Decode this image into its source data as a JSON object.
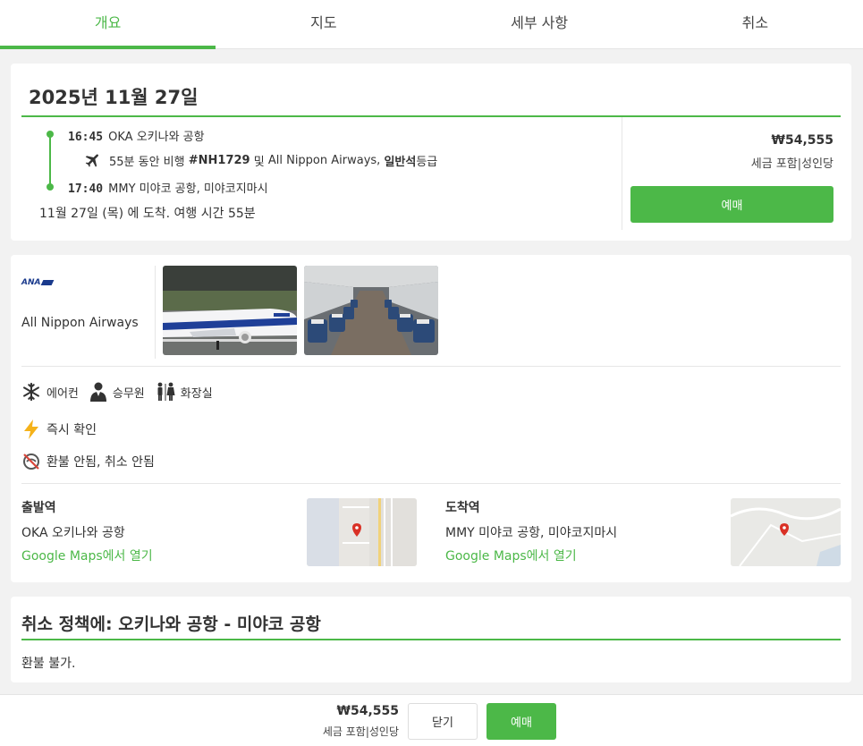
{
  "tabs": [
    {
      "label": "개요",
      "active": true
    },
    {
      "label": "지도"
    },
    {
      "label": "세부 사항"
    },
    {
      "label": "취소"
    }
  ],
  "summary": {
    "date": "2025년 11월 27일",
    "departure": {
      "time": "16:45",
      "place": "OKA 오키나와 공항"
    },
    "flight": {
      "duration": "55분 동안 비행",
      "number": "#NH1729",
      "connector": "및",
      "airline": "All Nippon Airways,",
      "class": "일반석",
      "class_suffix": "등급"
    },
    "arrival": {
      "time": "17:40",
      "place": "MMY 미야코 공항, 미야코지마시"
    },
    "arrive_text": "11월 27일 (목) 에 도착. 여행 시간 55분",
    "price": "₩54,555",
    "tax": "세금 포함|성인당",
    "book_label": "예매"
  },
  "details": {
    "airline_logo": "ANA",
    "airline_name": "All Nippon Airways",
    "amenities": [
      {
        "icon": "snowflake-icon",
        "label": "에어컨"
      },
      {
        "icon": "flight-attendant-icon",
        "label": "승무원"
      },
      {
        "icon": "restroom-icon",
        "label": "화장실"
      }
    ],
    "instant": "즉시 확인",
    "refund": "환불 안됨, 취소 안됨",
    "departure_station": {
      "heading": "출발역",
      "name": "OKA 오키나와 공항",
      "link": "Google Maps에서 열기"
    },
    "arrival_station": {
      "heading": "도착역",
      "name": "MMY 미야코 공항, 미야코지마시",
      "link": "Google Maps에서 열기"
    }
  },
  "policy": {
    "title": "취소 정책에: 오키나와 공항 - 미야코 공항",
    "text": "환불 불가."
  },
  "bottom": {
    "price": "₩54,555",
    "tax": "세금 포함|성인당",
    "close_label": "닫기",
    "book_label": "예매"
  },
  "colors": {
    "accent": "#4cb848",
    "ana_blue": "#1a3a8c"
  }
}
